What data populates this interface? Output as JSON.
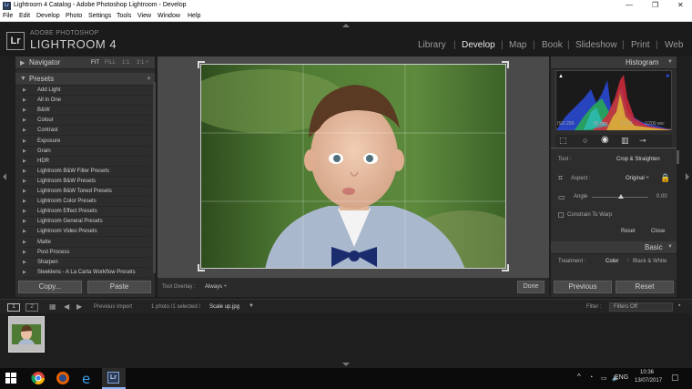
{
  "window": {
    "title": "Lightroom 4 Catalog - Adobe Photoshop Lightroom - Develop",
    "controls": [
      "—",
      "❐",
      "✕"
    ]
  },
  "menu": [
    "File",
    "Edit",
    "Develop",
    "Photo",
    "Settings",
    "Tools",
    "View",
    "Window",
    "Help"
  ],
  "app": {
    "logo": "Lr",
    "brand": "ADOBE PHOTOSHOP",
    "product": "LIGHTROOM 4"
  },
  "modules": [
    {
      "label": "Library",
      "active": false
    },
    {
      "label": "Develop",
      "active": true
    },
    {
      "label": "Map",
      "active": false
    },
    {
      "label": "Book",
      "active": false
    },
    {
      "label": "Slideshow",
      "active": false
    },
    {
      "label": "Print",
      "active": false
    },
    {
      "label": "Web",
      "active": false
    }
  ],
  "navigator": {
    "title": "Navigator",
    "zoom_options": [
      "FIT",
      "FILL",
      "1:1",
      "3:1 ÷"
    ]
  },
  "presets": {
    "title": "Presets",
    "add": "+",
    "items": [
      "Add Light",
      "All in One",
      "B&W",
      "Colour",
      "Contrast",
      "Exposure",
      "Grain",
      "HDR",
      "Lightroom B&W Filter Presets",
      "Lightroom B&W Presets",
      "Lightroom B&W Toned Presets",
      "Lightroom Color Presets",
      "Lightroom Effect Presets",
      "Lightroom General Presets",
      "Lightroom Video Presets",
      "Matte",
      "Post Process",
      "Sharpen",
      "Sleeklens - A La Carta Workflow Presets"
    ]
  },
  "left_buttons": {
    "copy": "Copy...",
    "paste": "Paste"
  },
  "toolbar": {
    "overlay_label": "Tool Overlay :",
    "overlay_value": "Always ÷",
    "done": "Done"
  },
  "histogram": {
    "title": "Histogram",
    "iso": "ISO 200",
    "focal": "85 mm",
    "aperture": "f / 1.8",
    "shutter": "1/200 sec"
  },
  "crop": {
    "tool_label": "Tool :",
    "tool_value": "Crop & Straighten",
    "aspect_label": "Aspect :",
    "aspect_value": "Original ÷",
    "angle_label": "Angle",
    "angle_value": "0.00",
    "constrain": "Constrain To Warp",
    "reset": "Reset",
    "close": "Close"
  },
  "basic": {
    "title": "Basic",
    "treatment_label": "Treatment :",
    "color": "Color",
    "bw": "Black & White"
  },
  "right_buttons": {
    "previous": "Previous",
    "reset": "Reset"
  },
  "filmstrip": {
    "page1": "1",
    "page2": "2",
    "previous_import": "Previous Import",
    "info": "1 photo /1 selected /",
    "filename": "Scale up.jpg",
    "filter_label": "Filter :",
    "filter_value": "Filters Off"
  },
  "taskbar": {
    "lang": "ENG",
    "time": "10:36",
    "date": "13/07/2017"
  }
}
